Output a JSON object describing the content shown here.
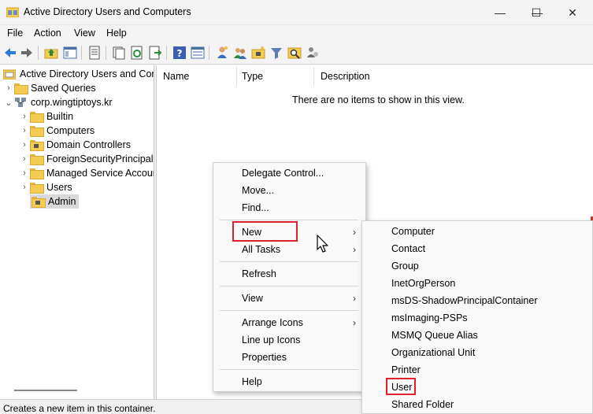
{
  "window": {
    "title": "Active Directory Users and Computers",
    "controls": {
      "minimize": "—",
      "maximize": "☐",
      "close": "✕"
    }
  },
  "menubar": [
    "File",
    "Action",
    "View",
    "Help"
  ],
  "toolbar_icons": [
    "back-icon",
    "forward-icon",
    "up-folder-icon",
    "show-tree-icon",
    "properties-sheet-icon",
    "copy-icon",
    "refresh-icon",
    "export-list-icon",
    "help-icon",
    "mmc-view-icon",
    "add-user-icon",
    "add-group-icon",
    "add-ou-icon",
    "filter-icon",
    "find-icon",
    "delegate-icon"
  ],
  "tree": {
    "root": "Active Directory Users and Com",
    "saved_queries": "Saved Queries",
    "domain": "corp.wingtiptoys.kr",
    "children": [
      "Builtin",
      "Computers",
      "Domain Controllers",
      "ForeignSecurityPrincipals",
      "Managed Service Accounts",
      "Users",
      "Admin"
    ],
    "selected": "Admin"
  },
  "list": {
    "columns": [
      "Name",
      "Type",
      "Description"
    ],
    "empty_message": "There are no items to show in this view."
  },
  "context_menu": {
    "items": [
      "Delegate Control...",
      "Move...",
      "Find...",
      "New",
      "All Tasks",
      "Refresh",
      "View",
      "Arrange Icons",
      "Line up Icons",
      "Properties",
      "Help"
    ]
  },
  "new_submenu": {
    "items": [
      "Computer",
      "Contact",
      "Group",
      "InetOrgPerson",
      "msDS-ShadowPrincipalContainer",
      "msImaging-PSPs",
      "MSMQ Queue Alias",
      "Organizational Unit",
      "Printer",
      "User",
      "Shared Folder"
    ]
  },
  "status_text": "Creates a new item in this container.",
  "colors": {
    "highlight_box": "#e0202a",
    "folder": "#f5cc52",
    "selection": "#d9d9d9"
  }
}
